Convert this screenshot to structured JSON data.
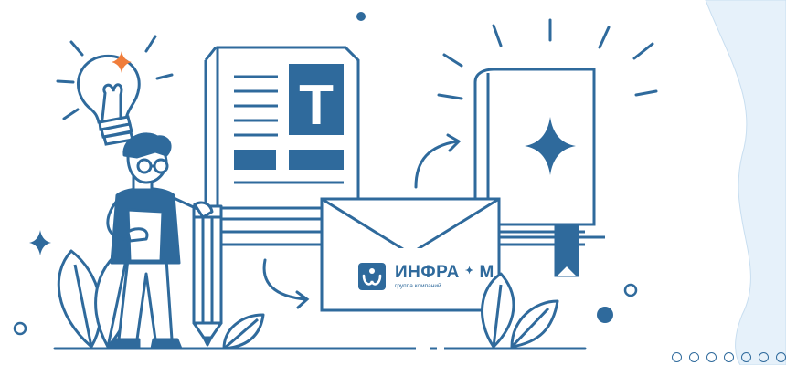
{
  "banner": {
    "brand_name": "ИНФРА",
    "brand_suffix": "М",
    "brand_tagline": "группа компаний",
    "document_letter": "T"
  },
  "carousel": {
    "slide_count": 7,
    "active_index": null
  },
  "colors": {
    "primary": "#2f6a9c",
    "accent": "#f07d3b",
    "panel": "#e6f1fa",
    "background": "#ffffff"
  }
}
